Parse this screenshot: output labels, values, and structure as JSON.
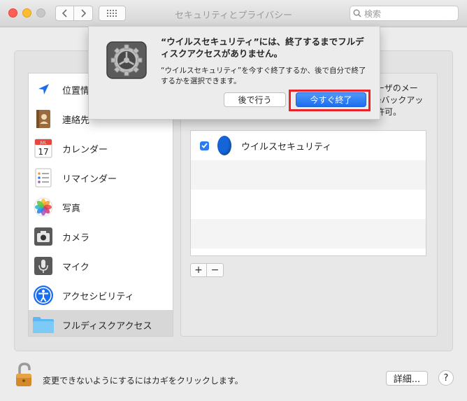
{
  "window": {
    "title": "セキュリティとプライバシー"
  },
  "toolbar": {
    "search_placeholder": "検索"
  },
  "sidebar": {
    "items": [
      {
        "label": "位置情報サービス",
        "icon": "location-arrow-icon"
      },
      {
        "label": "連絡先",
        "icon": "contacts-book-icon"
      },
      {
        "label": "カレンダー",
        "icon": "calendar-icon",
        "icon_month": "JUL",
        "icon_day": "17"
      },
      {
        "label": "リマインダー",
        "icon": "reminders-icon"
      },
      {
        "label": "写真",
        "icon": "photos-icon"
      },
      {
        "label": "カメラ",
        "icon": "camera-icon"
      },
      {
        "label": "マイク",
        "icon": "microphone-icon"
      },
      {
        "label": "アクセシビリティ",
        "icon": "accessibility-icon"
      },
      {
        "label": "フルディスクアクセス",
        "icon": "folder-icon",
        "selected": true
      }
    ]
  },
  "panel": {
    "description_lines": [
      "ーザのメー",
      "eバックアッ",
      "許可。"
    ],
    "apps": [
      {
        "name": "ウイルスセキュリティ",
        "checked": true
      }
    ],
    "add_label": "+",
    "remove_label": "−"
  },
  "footer": {
    "lock_text": "変更できないようにするにはカギをクリックします。",
    "details_label": "詳細...",
    "help_label": "?"
  },
  "alert": {
    "title": "“ウイルスセキュリティ”には、終了するまでフルディスクアクセスがありません。",
    "message": "“ウイルスセキュリティ”を今すぐ終了するか、後で自分で終了するかを選択できます。",
    "later_label": "後で行う",
    "quit_label": "今すぐ終了"
  },
  "colors": {
    "accent": "#1c6ef0",
    "highlight": "#e8232a"
  }
}
